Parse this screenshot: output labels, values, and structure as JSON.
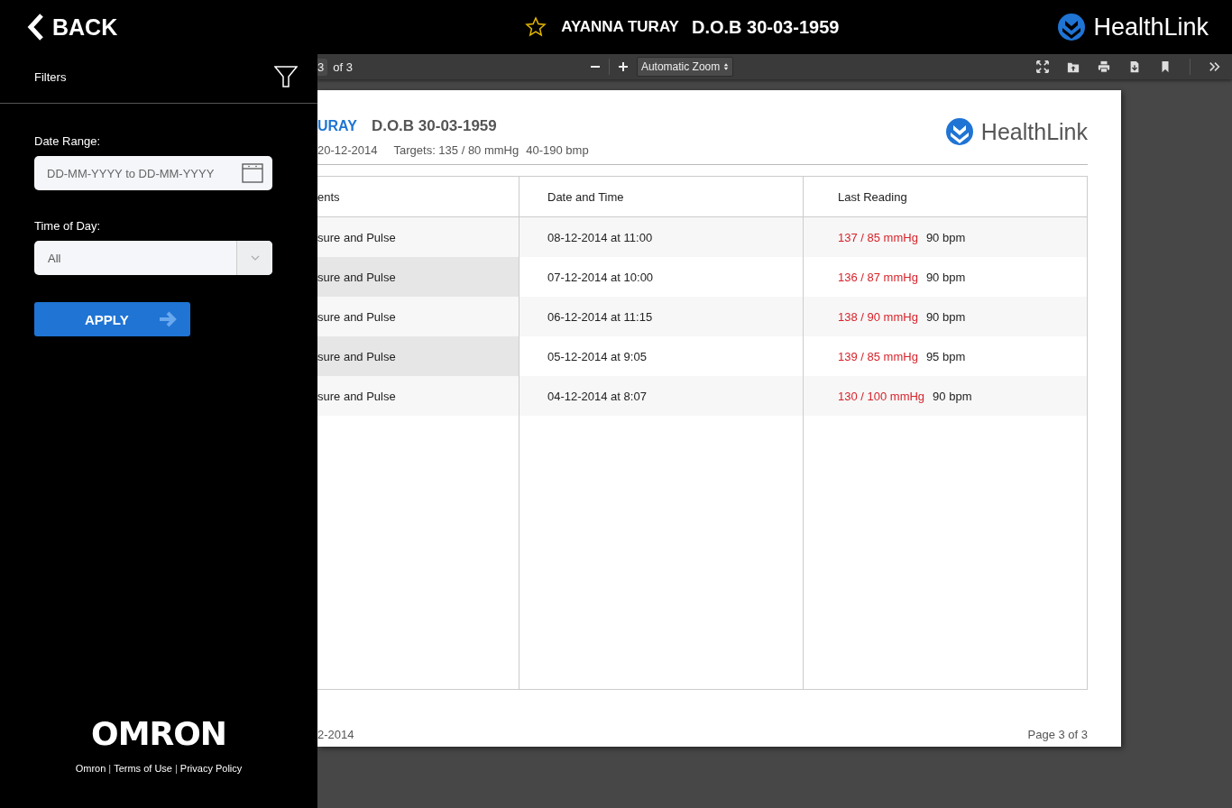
{
  "header": {
    "back_label": "BACK",
    "starred": false,
    "patient_name": "AYANNA TURAY",
    "dob": "D.O.B 30-03-1959",
    "brand": "Health**Link**"
  },
  "filters": {
    "title": "Filters",
    "date_range": {
      "label": "Date Range:",
      "placeholder": "DD-MM-YYYY to DD-MM-YYYY"
    },
    "time_of_day": {
      "label": "Time of Day:",
      "value": "All"
    },
    "apply_label": "APPLY"
  },
  "sidebar_footer": {
    "logo": "OMRON",
    "links": [
      {
        "kind": "link",
        "text": "Omron"
      },
      {
        "kind": "separator",
        "text": "|"
      },
      {
        "kind": "link",
        "text": "Terms of Use"
      },
      {
        "kind": "separator",
        "text": "|"
      },
      {
        "kind": "link",
        "text": "Privacy Policy"
      }
    ]
  },
  "viewer_toolbar": {
    "page_number": "3",
    "page_count": "of 3",
    "zoom": "Automatic Zoom"
  },
  "document": {
    "title": "URAY",
    "dob": "D.O.B 30-03-1959",
    "date": "20-12-2014",
    "targets": "Targets: 135 / 80 mmHg",
    "pulse_range": "40-190 bmp",
    "brand": "Health**Link**",
    "columns": [
      "ents",
      "Date and Time",
      "Last Reading"
    ],
    "rows": [
      {
        "type": "sure and Pulse",
        "datetime": "08-12-2014 at 11:00",
        "pressure": "137 / 85 mmHg",
        "pulse": "90 bpm"
      },
      {
        "type": "sure and Pulse",
        "datetime": "07-12-2014 at 10:00",
        "pressure": "136 / 87 mmHg",
        "pulse": "90 bpm"
      },
      {
        "type": "sure and Pulse",
        "datetime": "06-12-2014 at 11:15",
        "pressure": "138 / 90 mmHg",
        "pulse": "90 bpm"
      },
      {
        "type": "sure and Pulse",
        "datetime": "05-12-2014 at 9:05",
        "pressure": "139 / 85 mmHg",
        "pulse": "95 bpm"
      },
      {
        "type": "sure and Pulse",
        "datetime": "04-12-2014 at 8:07",
        "pressure": "130 / 100 mmHg",
        "pulse": "90 bpm"
      }
    ],
    "footer_date": "2-2014",
    "page_label": "Page 3 of 3"
  }
}
